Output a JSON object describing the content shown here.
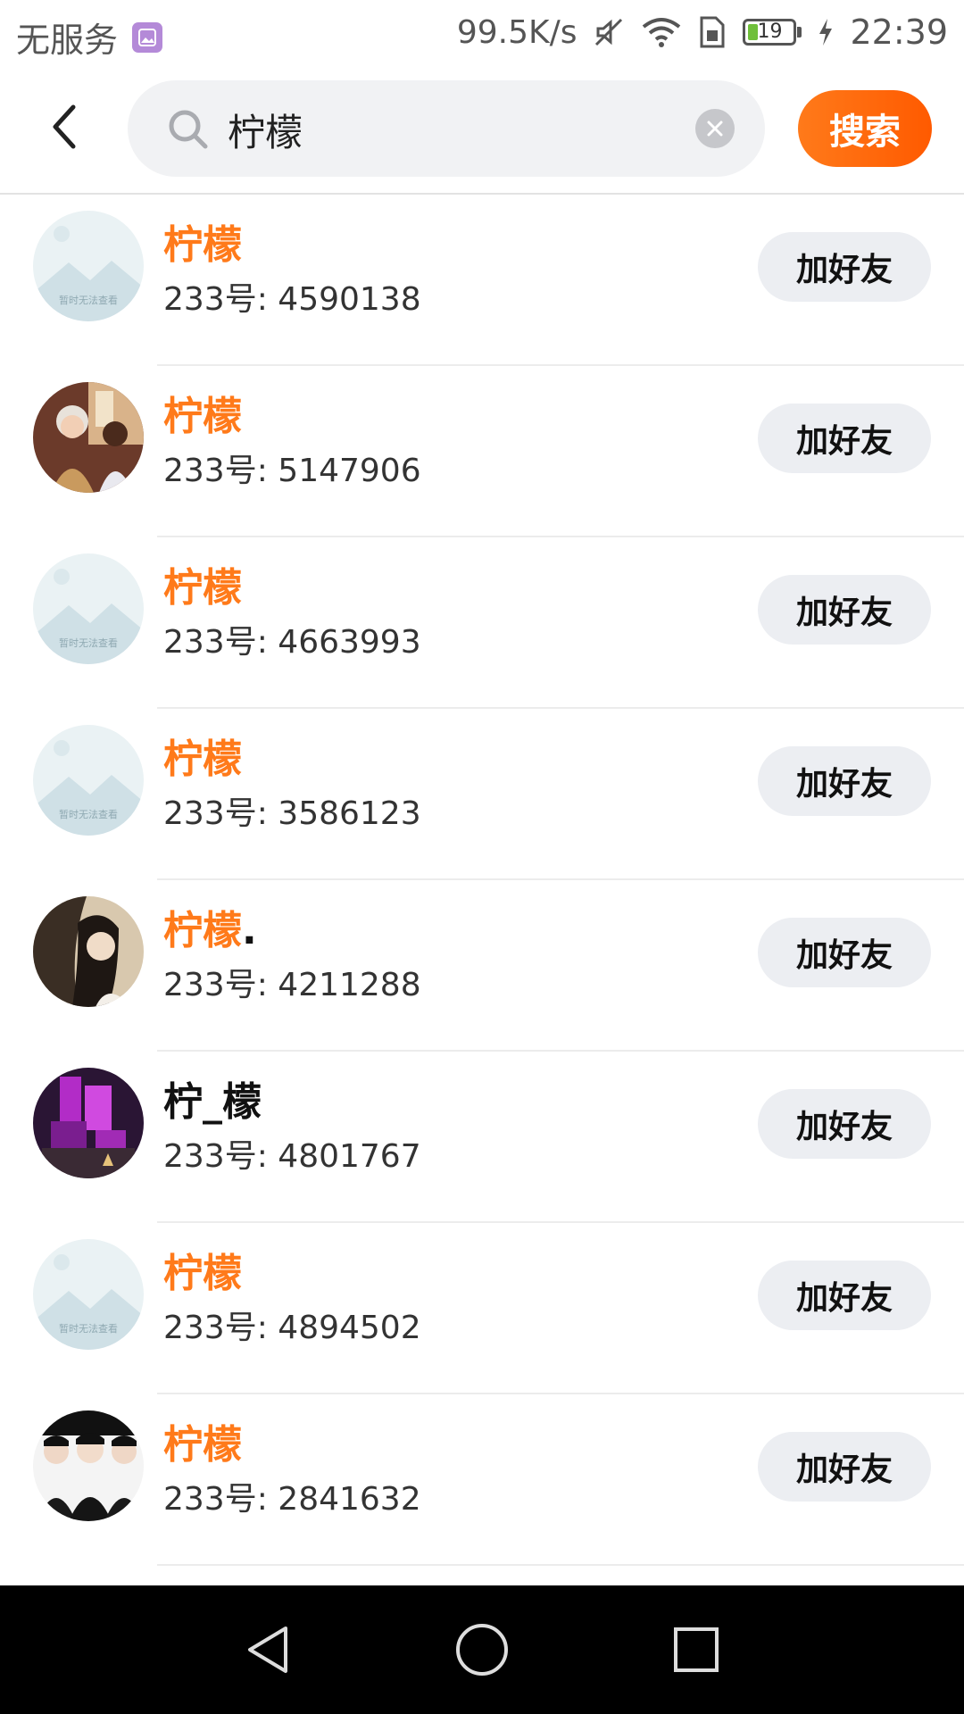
{
  "status_bar": {
    "carrier": "无服务",
    "speed": "99.5K/s",
    "battery": "19",
    "time": "22:39"
  },
  "search": {
    "query": "柠檬",
    "search_button": "搜索"
  },
  "results": [
    {
      "name": "柠檬",
      "uid": "233号: 4590138",
      "action": "加好友",
      "avatar": "placeholder-image"
    },
    {
      "name": "柠檬",
      "uid": "233号: 5147906",
      "action": "加好友",
      "avatar": "illustrated-couple"
    },
    {
      "name": "柠檬",
      "uid": "233号: 4663993",
      "action": "加好友",
      "avatar": "placeholder-image"
    },
    {
      "name": "柠檬",
      "uid": "233号: 3586123",
      "action": "加好友",
      "avatar": "placeholder-image"
    },
    {
      "name": "柠檬",
      "name_suffix": ".",
      "uid": "233号: 4211288",
      "action": "加好友",
      "avatar": "girl-portrait"
    },
    {
      "name": "柠_檬",
      "uid": "233号: 4801767",
      "action": "加好友",
      "avatar": "purple-scene"
    },
    {
      "name": "柠檬",
      "uid": "233号: 4894502",
      "action": "加好友",
      "avatar": "placeholder-image"
    },
    {
      "name": "柠檬",
      "uid": "233号: 2841632",
      "action": "加好友",
      "avatar": "group-photo"
    }
  ],
  "avatar_placeholder_text": "暂时无法查看",
  "colors": {
    "accent": "#ff7a1a",
    "button_bg": "#eceef2"
  },
  "nav_icons": [
    "back-triangle-icon",
    "home-circle-icon",
    "recent-square-icon"
  ]
}
